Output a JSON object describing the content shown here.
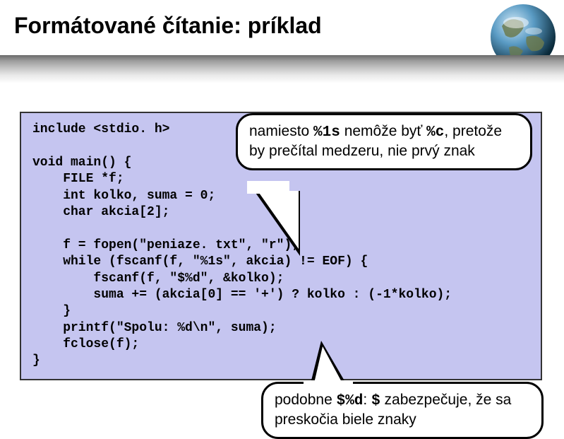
{
  "title": "Formátované čítanie: príklad",
  "code_lines": [
    "include <stdio. h>",
    "",
    "void main() {",
    "    FILE *f;",
    "    int kolko, suma = 0;",
    "    char akcia[2];",
    "",
    "    f = fopen(\"peniaze. txt\", \"r\");",
    "    while (fscanf(f, \"%1s\", akcia) != EOF) {",
    "        fscanf(f, \"$%d\", &kolko);",
    "        suma += (akcia[0] == '+') ? kolko : (-1*kolko);",
    "    }",
    "    printf(\"Spolu: %d\\n\", suma);",
    "    fclose(f);",
    "}"
  ],
  "callout1": {
    "prefix": "namiesto ",
    "code1": "%1s",
    "mid1": " nemôže byť ",
    "code2": "%c",
    "suffix": ", pretože by prečítal medzeru, nie prvý znak"
  },
  "callout2": {
    "prefix": "podobne ",
    "code1": "$%d",
    "mid1": ": ",
    "code2": "$",
    "suffix": " zabezpečuje, že sa preskočia biele znaky"
  },
  "icons": {
    "earth": "earth-globe"
  }
}
